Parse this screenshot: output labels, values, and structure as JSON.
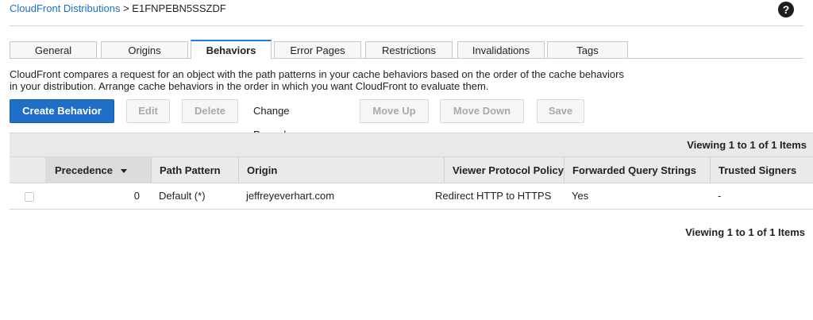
{
  "breadcrumb": {
    "parent": "CloudFront Distributions",
    "separator": ">",
    "current": "E1FNPEBN5SSZDF"
  },
  "help_icon_glyph": "?",
  "tabs": [
    {
      "label": "General",
      "active": false
    },
    {
      "label": "Origins",
      "active": false
    },
    {
      "label": "Behaviors",
      "active": true
    },
    {
      "label": "Error Pages",
      "active": false
    },
    {
      "label": "Restrictions",
      "active": false
    },
    {
      "label": "Invalidations",
      "active": false
    },
    {
      "label": "Tags",
      "active": false
    }
  ],
  "description": "CloudFront compares a request for an object with the path patterns in your cache behaviors based on the order of the cache behaviors in your distribution. Arrange cache behaviors in the order in which you want CloudFront to evaluate them.",
  "toolbar": {
    "create": "Create Behavior",
    "edit": "Edit",
    "delete": "Delete",
    "change_precedence": "Change Precedence:",
    "move_up": "Move Up",
    "move_down": "Move Down",
    "save": "Save"
  },
  "table": {
    "viewing": "Viewing 1 to 1 of 1 Items",
    "columns": [
      "Precedence",
      "Path Pattern",
      "Origin",
      "Viewer Protocol Policy",
      "Forwarded Query Strings",
      "Trusted Signers"
    ],
    "rows": [
      {
        "precedence": "0",
        "path_pattern": "Default (*)",
        "origin": "jeffreyeverhart.com",
        "viewer_protocol_policy": "Redirect HTTP to HTTPS",
        "forwarded_query_strings": "Yes",
        "trusted_signers": "-"
      }
    ]
  },
  "footer_viewing": "Viewing 1 to 1 of 1 Items",
  "colors": {
    "accent": "#1f6fc9",
    "link": "#1a73c9",
    "tab_active_border": "#1b7be0"
  }
}
